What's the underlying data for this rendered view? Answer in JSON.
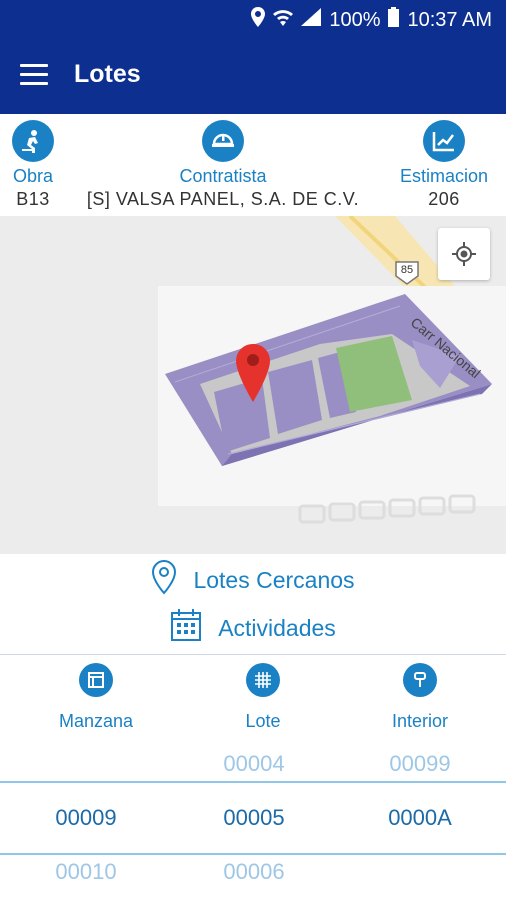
{
  "status": {
    "battery": "100%",
    "time": "10:37 AM"
  },
  "appbar": {
    "title": "Lotes"
  },
  "info": {
    "obra": {
      "label": "Obra",
      "value": "B13"
    },
    "contratista": {
      "label": "Contratista",
      "value": "[S] VALSA PANEL, S.A. DE C.V."
    },
    "estimacion": {
      "label": "Estimacion",
      "value": "206"
    }
  },
  "map": {
    "road_label": "Carr Nacional",
    "highway_shield": "85"
  },
  "actions": {
    "nearby": "Lotes Cercanos",
    "activities": "Actividades"
  },
  "table": {
    "columns": [
      "Manzana",
      "Lote",
      "Interior"
    ],
    "rows": [
      [
        "",
        "00004",
        "00099"
      ],
      [
        "00009",
        "00005",
        "0000A"
      ],
      [
        "00010",
        "00006",
        ""
      ]
    ]
  }
}
